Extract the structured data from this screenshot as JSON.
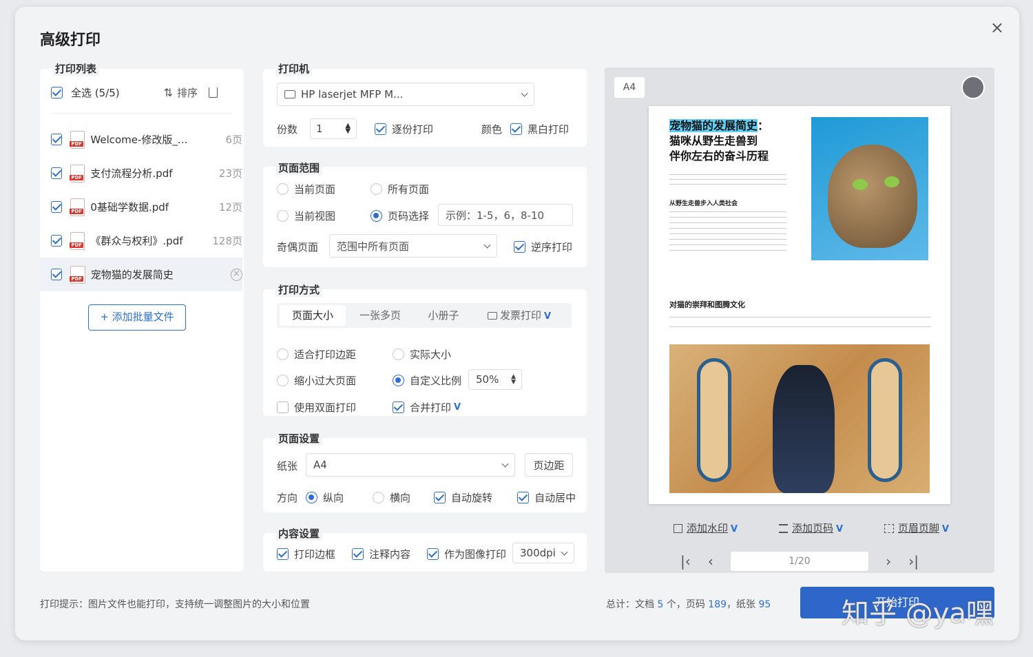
{
  "dialog": {
    "title": "高级打印"
  },
  "print_list": {
    "section_title": "打印列表",
    "select_all": "全选 (5/5)",
    "sort_label": "排序",
    "files": [
      {
        "name": "Welcome-修改版_...",
        "pages": "6页"
      },
      {
        "name": "支付流程分析.pdf",
        "pages": "23页"
      },
      {
        "name": "0基础学数据.pdf",
        "pages": "12页"
      },
      {
        "name": "《群众与权利》.pdf",
        "pages": "128页"
      },
      {
        "name": "宠物猫的发展简史",
        "pages": ""
      }
    ],
    "add_button": "+ 添加批量文件"
  },
  "printer": {
    "section_title": "打印机",
    "name": "HP laserjet MFP M...",
    "copies_label": "份数",
    "copies_value": "1",
    "collate_label": "逐份打印",
    "color_label": "颜色",
    "bw_label": "黑白打印"
  },
  "page_range": {
    "section_title": "页面范围",
    "current_page": "当前页面",
    "all_pages": "所有页面",
    "current_view": "当前视图",
    "page_select": "页码选择",
    "page_select_placeholder": "示例：1-5，6，8-10",
    "odd_even_label": "奇偶页面",
    "odd_even_value": "范围中所有页面",
    "reverse_label": "逆序打印"
  },
  "print_mode": {
    "section_title": "打印方式",
    "tabs": [
      "页面大小",
      "一张多页",
      "小册子",
      "发票打印"
    ],
    "fit_margin": "适合打印边距",
    "actual_size": "实际大小",
    "shrink": "缩小过大页面",
    "custom_scale": "自定义比例",
    "scale_value": "50%",
    "duplex": "使用双面打印",
    "merge": "合并打印"
  },
  "page_setup": {
    "section_title": "页面设置",
    "paper_label": "纸张",
    "paper_value": "A4",
    "margin_button": "页边距",
    "orientation_label": "方向",
    "portrait": "纵向",
    "landscape": "横向",
    "auto_rotate": "自动旋转",
    "auto_center": "自动居中"
  },
  "content_setup": {
    "section_title": "内容设置",
    "print_border": "打印边框",
    "annotations": "注释内容",
    "as_image": "作为图像打印",
    "dpi": "300dpi"
  },
  "preview": {
    "paper": "A4",
    "doc_title_hl": "宠物猫的发展简史",
    "doc_title_rest": "：",
    "doc_title_line2": "猫咪从野生走兽到",
    "doc_title_line3": "伴你左右的奋斗历程",
    "doc_sub1": "从野生走兽步入人类社会",
    "doc_sub2": "对猫的崇拜和图腾文化",
    "watermark": "添加水印",
    "page_number": "添加页码",
    "header_footer": "页眉页脚",
    "page_indicator": "1/20"
  },
  "footer": {
    "hint": "打印提示：图片文件也能打印，支持统一调整图片的大小和位置",
    "total_prefix": "总计：文档",
    "docs": "5",
    "docs_unit": "个，页码",
    "pages": "189",
    "paper_prefix": "，纸张",
    "paper": "95",
    "print_button": "开始打印",
    "overlay_text": "知乎 @ya嘿"
  },
  "colors": {
    "accent": "#2d6fcf",
    "button": "#2f66c9"
  }
}
